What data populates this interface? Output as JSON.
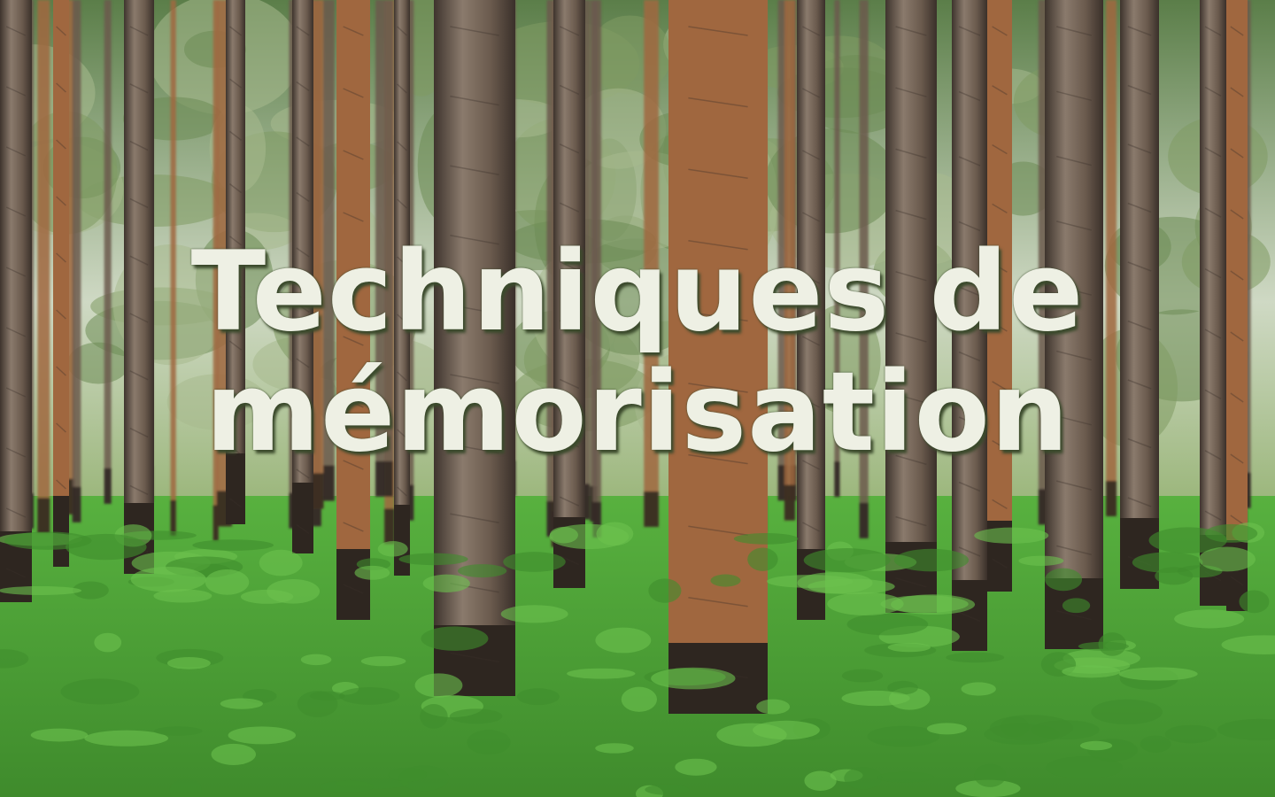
{
  "slide": {
    "title_lines": [
      "Techniques de",
      "mémorisation"
    ],
    "background": "photo-pine-forest",
    "colors": {
      "title": "#eef0e4",
      "title_shadow": "#3b4a2c",
      "sky": "#cfd9c4",
      "canopy": "#5b7e49",
      "grass": "#58b13f",
      "grass_dark": "#3f8b2c",
      "trunk": "#6b5a4e",
      "trunk_orange": "#a0673f",
      "trunk_base": "#2e2620"
    }
  }
}
